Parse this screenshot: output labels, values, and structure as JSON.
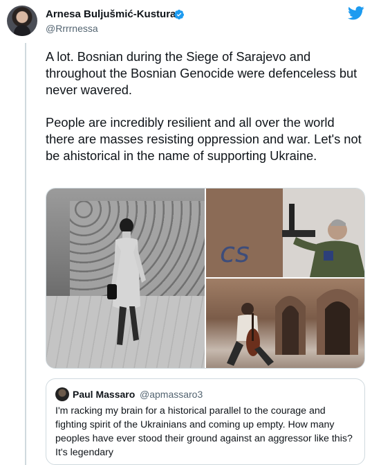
{
  "author": {
    "name": "Arnesa Buljušmić-Kustura",
    "handle": "@Rrrrnessa",
    "verified": true
  },
  "icons": {
    "verified": "verified-badge-icon",
    "brand": "twitter-bird-icon"
  },
  "colors": {
    "brand_blue": "#1d9bf0",
    "text_primary": "#0f1419",
    "text_secondary": "#536471",
    "border": "#cfd9de"
  },
  "tweet": {
    "paragraphs": [
      "A lot. Bosnian during the Siege of Sarajevo and throughout the Bosnian Genocide were defenceless but never wavered.",
      "People are incredibly resilient and all over the world there are masses resisting oppression and war. Let's not be ahistorical in the name of supporting Ukraine."
    ]
  },
  "media": {
    "count": 3,
    "graffiti_text": "cs"
  },
  "quoted_tweet": {
    "name": "Paul Massaro",
    "handle": "@apmassaro3",
    "text": "I'm racking my brain for a historical parallel to the courage and fighting spirit of the Ukrainians and coming up empty. How many peoples have ever stood their ground against an aggressor like this? It's legendary"
  }
}
